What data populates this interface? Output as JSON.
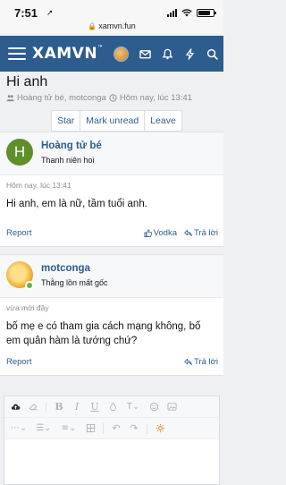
{
  "status": {
    "time": "7:51",
    "url": "xamvn.fun"
  },
  "header": {
    "logo": "XAMVN"
  },
  "thread": {
    "title": "Hi anh",
    "participants": "Hoàng tử bé, motconga",
    "date": "Hôm nay, lúc 13:41",
    "actions": [
      "Star",
      "Mark unread",
      "Leave"
    ]
  },
  "posts": [
    {
      "avatar_letter": "H",
      "avatar_color": "#5e8f2a",
      "author": "Hoàng tử bé",
      "user_title": "Thanh niên hoi",
      "time": "Hôm nay, lúc 13:41",
      "body": "Hi anh, em là nữ, tầm tuổi anh.",
      "report": "Report",
      "reaction": "Vodka",
      "reply": "Trả lời"
    },
    {
      "author": "motconga",
      "user_title": "Thằng lồn mất gốc",
      "time": "vừa mới đây",
      "body": "bố mẹ e có tham gia cách mạng không, bố em quân hàm là tướng chứ?",
      "report": "Report",
      "reply": "Trả lời"
    }
  ],
  "colors": {
    "brand": "#2d5c8f",
    "online": "#67b14a"
  }
}
